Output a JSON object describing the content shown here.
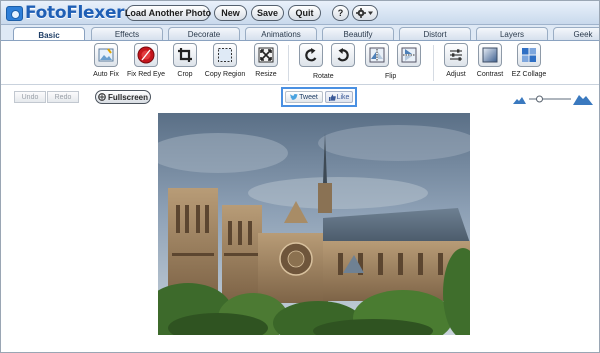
{
  "app": {
    "logo_text": "FotoFlexer"
  },
  "topbar": {
    "load_label": "Load Another Photo",
    "new_label": "New",
    "save_label": "Save",
    "quit_label": "Quit",
    "help_label": "?"
  },
  "tabs": [
    {
      "label": "Basic"
    },
    {
      "label": "Effects"
    },
    {
      "label": "Decorate"
    },
    {
      "label": "Animations"
    },
    {
      "label": "Beautify"
    },
    {
      "label": "Distort"
    },
    {
      "label": "Layers"
    },
    {
      "label": "Geek"
    }
  ],
  "toolbar": {
    "auto_fix": "Auto Fix",
    "fix_red_eye": "Fix Red Eye",
    "crop": "Crop",
    "copy_region": "Copy Region",
    "resize": "Resize",
    "rotate": "Rotate",
    "flip": "Flip",
    "adjust": "Adjust",
    "contrast": "Contrast",
    "ez_collage": "EZ Collage"
  },
  "status": {
    "undo_label": "Undo",
    "redo_label": "Redo",
    "fullscreen_label": "Fullscreen",
    "tweet_label": "Tweet",
    "like_label": "Like",
    "zoom_level": 0.25
  },
  "colors": {
    "accent": "#1f5fb5",
    "social_border": "#4a90e2",
    "like_blue": "#3b5998"
  }
}
